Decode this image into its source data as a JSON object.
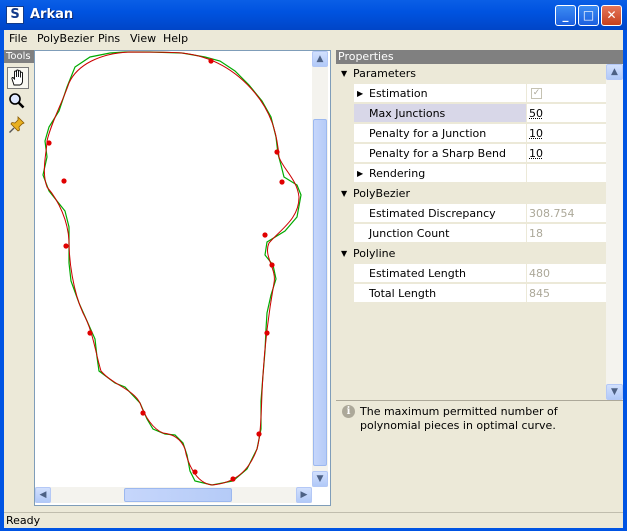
{
  "window": {
    "title": "Arkan",
    "app_icon": "arkan-logo-icon",
    "minimize_icon": "minimize-icon",
    "maximize_icon": "maximize-icon",
    "close_icon": "close-icon"
  },
  "menu": [
    {
      "label": "File"
    },
    {
      "label": "PolyBezier"
    },
    {
      "label": "Pins"
    },
    {
      "label": "View"
    },
    {
      "label": "Help"
    }
  ],
  "tools": {
    "title": "Tools",
    "items": [
      {
        "name": "hand-tool",
        "icon": "hand-icon",
        "pressed": true
      },
      {
        "name": "zoom-tool",
        "icon": "magnifier-icon",
        "pressed": false
      },
      {
        "name": "pin-tool",
        "icon": "pushpin-icon",
        "pressed": false
      }
    ]
  },
  "canvas": {
    "curve_color": "#cc0000",
    "polyline_color": "#00aa00",
    "junction_color": "#e00000"
  },
  "properties": {
    "title": "Properties",
    "rows": [
      {
        "type": "category",
        "label": "Parameters",
        "expanded": true
      },
      {
        "type": "group",
        "label": "Estimation",
        "value_kind": "check",
        "checked": true
      },
      {
        "type": "prop",
        "label": "Max Junctions",
        "value": "50",
        "selected": true
      },
      {
        "type": "prop",
        "label": "Penalty for a Junction",
        "value": "10"
      },
      {
        "type": "prop",
        "label": "Penalty for a Sharp Bend",
        "value": "10"
      },
      {
        "type": "group",
        "label": "Rendering",
        "value": ""
      },
      {
        "type": "category",
        "label": "PolyBezier",
        "expanded": true
      },
      {
        "type": "prop",
        "label": "Estimated Discrepancy",
        "value": "308.754",
        "readonly": true
      },
      {
        "type": "prop",
        "label": "Junction Count",
        "value": "18",
        "readonly": true
      },
      {
        "type": "category",
        "label": "Polyline",
        "expanded": true
      },
      {
        "type": "prop",
        "label": "Estimated Length",
        "value": "480",
        "readonly": true
      },
      {
        "type": "prop",
        "label": "Total Length",
        "value": "845",
        "readonly": true
      }
    ],
    "description": "The maximum permitted number of polynomial pieces in optimal curve.",
    "description_icon": "info-icon"
  },
  "status": {
    "text": "Ready"
  }
}
